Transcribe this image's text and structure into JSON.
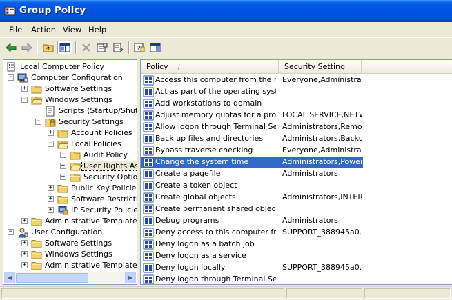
{
  "window": {
    "title": "Group Policy"
  },
  "menu": [
    "File",
    "Action",
    "View",
    "Help"
  ],
  "toolbar": [
    "back-icon",
    "forward-icon",
    "up-folder-icon",
    "show-tree-icon",
    "delete-icon",
    "properties-icon",
    "export-icon",
    "help-icon",
    "show-hide-icon"
  ],
  "tree": [
    {
      "label": "Local Computer Policy",
      "level": 0,
      "icon": "computer-policy-icon",
      "exp": ""
    },
    {
      "label": "Computer Configuration",
      "level": 1,
      "icon": "computer-icon",
      "exp": "-"
    },
    {
      "label": "Software Settings",
      "level": 2,
      "icon": "folder-icon",
      "exp": "+"
    },
    {
      "label": "Windows Settings",
      "level": 2,
      "icon": "folder-icon",
      "exp": "-"
    },
    {
      "label": "Scripts (Startup/Shutdown)",
      "level": 3,
      "icon": "scripts-icon",
      "exp": ""
    },
    {
      "label": "Security Settings",
      "level": 3,
      "icon": "security-icon",
      "exp": "-"
    },
    {
      "label": "Account Policies",
      "level": 4,
      "icon": "folder-icon",
      "exp": "+"
    },
    {
      "label": "Local Policies",
      "level": 4,
      "icon": "folder-icon",
      "exp": "-"
    },
    {
      "label": "Audit Policy",
      "level": 5,
      "icon": "folder-icon",
      "exp": "+"
    },
    {
      "label": "User Rights Assignment",
      "level": 5,
      "icon": "folder-icon",
      "exp": "+",
      "selected": true
    },
    {
      "label": "Security Options",
      "level": 5,
      "icon": "folder-icon",
      "exp": "+"
    },
    {
      "label": "Public Key Policies",
      "level": 4,
      "icon": "folder-icon",
      "exp": "+"
    },
    {
      "label": "Software Restriction Policies",
      "level": 4,
      "icon": "folder-icon",
      "exp": "+"
    },
    {
      "label": "IP Security Policies on Local Computer",
      "level": 4,
      "icon": "ip-security-icon",
      "exp": "+"
    },
    {
      "label": "Administrative Templates",
      "level": 2,
      "icon": "folder-icon",
      "exp": "+"
    },
    {
      "label": "User Configuration",
      "level": 1,
      "icon": "user-icon",
      "exp": "-"
    },
    {
      "label": "Software Settings",
      "level": 2,
      "icon": "folder-icon",
      "exp": "+"
    },
    {
      "label": "Windows Settings",
      "level": 2,
      "icon": "folder-icon",
      "exp": "+"
    },
    {
      "label": "Administrative Templates",
      "level": 2,
      "icon": "folder-icon",
      "exp": "+"
    }
  ],
  "list": {
    "columns": [
      "Policy",
      "Security Setting"
    ],
    "sort_indicator": "/",
    "rows": [
      {
        "policy": "Access this computer from the network",
        "setting": "Everyone,Administrators,..."
      },
      {
        "policy": "Act as part of the operating system",
        "setting": ""
      },
      {
        "policy": "Add workstations to domain",
        "setting": ""
      },
      {
        "policy": "Adjust memory quotas for a process",
        "setting": "LOCAL SERVICE,NETWORK..."
      },
      {
        "policy": "Allow logon through Terminal Services",
        "setting": "Administrators,Remote..."
      },
      {
        "policy": "Back up files and directories",
        "setting": "Administrators,Backup..."
      },
      {
        "policy": "Bypass traverse checking",
        "setting": "Everyone,Administrators,..."
      },
      {
        "policy": "Change the system time",
        "setting": "Administrators,Power Users",
        "selected": true
      },
      {
        "policy": "Create a pagefile",
        "setting": "Administrators"
      },
      {
        "policy": "Create a token object",
        "setting": ""
      },
      {
        "policy": "Create global objects",
        "setting": "Administrators,INTERACTIVE..."
      },
      {
        "policy": "Create permanent shared objects",
        "setting": ""
      },
      {
        "policy": "Debug programs",
        "setting": "Administrators"
      },
      {
        "policy": "Deny access to this computer from the network",
        "setting": "SUPPORT_388945a0..."
      },
      {
        "policy": "Deny logon as a batch job",
        "setting": ""
      },
      {
        "policy": "Deny logon as a service",
        "setting": ""
      },
      {
        "policy": "Deny logon locally",
        "setting": "SUPPORT_388945a0..."
      },
      {
        "policy": "Deny logon through Terminal Services",
        "setting": ""
      }
    ]
  }
}
